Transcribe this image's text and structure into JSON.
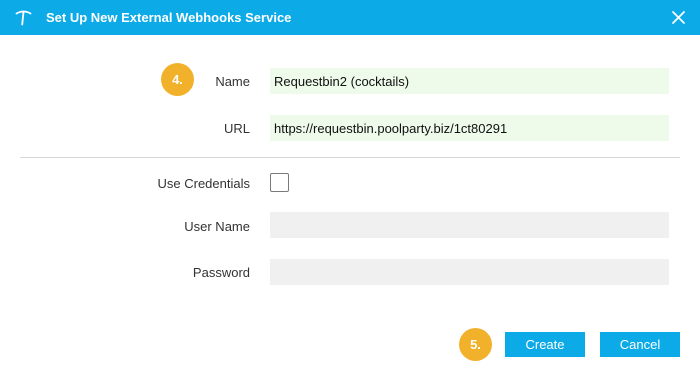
{
  "window": {
    "title": "Set Up New External Webhooks Service",
    "title_icon": "pickaxe-logo-icon",
    "close_icon": "close-icon",
    "accent_color": "#0cabe8"
  },
  "steps": {
    "name_step": "4.",
    "buttons_step": "5.",
    "badge_color": "#f1b12a"
  },
  "form": {
    "name": {
      "label": "Name",
      "value": "Requestbin2 (cocktails)"
    },
    "url": {
      "label": "URL",
      "value": "https://requestbin.poolparty.biz/1ct80291"
    },
    "use_credentials": {
      "label": "Use Credentials",
      "checked": false
    },
    "user_name": {
      "label": "User Name",
      "value": ""
    },
    "password": {
      "label": "Password",
      "value": ""
    }
  },
  "buttons": {
    "create": "Create",
    "cancel": "Cancel"
  }
}
